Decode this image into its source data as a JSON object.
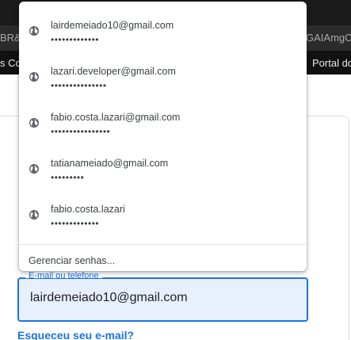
{
  "browser": {
    "bookmark_fragment_left": "BR&",
    "bookmark_fragment_right": "GAIAmgC",
    "nav_fragment_left": "s Co",
    "nav_fragment_right": "Portal do"
  },
  "autofill": {
    "items": [
      {
        "username": "lairdemeiado10@gmail.com",
        "password": "•••••••••••••",
        "icon": "globe-icon"
      },
      {
        "username": "lazari.developer@gmail.com",
        "password": "•••••••••••••••",
        "icon": "globe-icon"
      },
      {
        "username": "fabio.costa.lazari@gmail.com",
        "password": "••••••••••••••••",
        "icon": "globe-icon"
      },
      {
        "username": "tatianameiado@gmail.com",
        "password": "•••••••••",
        "icon": "globe-icon"
      },
      {
        "username": "fabio.costa.lazari",
        "password": "•••••••••••••",
        "icon": "globe-icon"
      }
    ],
    "manage_label": "Gerenciar senhas..."
  },
  "form": {
    "email_label": "E-mail ou telefone",
    "email_value": "lairdemeiado10@gmail.com",
    "forgot_email": "Esqueceu seu e-mail?"
  },
  "colors": {
    "accent": "#1a73e8",
    "field_fill": "#e8f0fe"
  }
}
